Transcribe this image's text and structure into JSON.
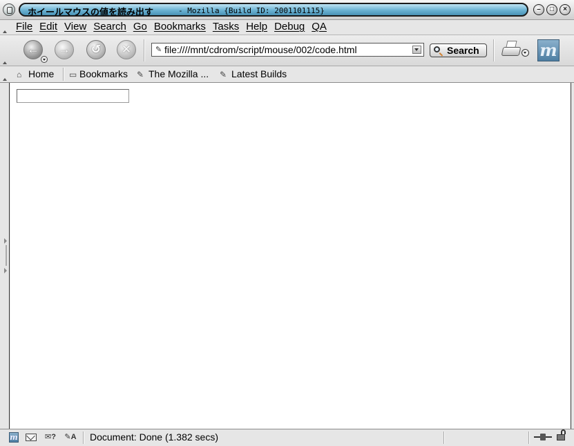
{
  "window": {
    "title_main": "ホイールマウスの値を読み出す",
    "title_sub": "- Mozilla {Build ID: 2001101115}"
  },
  "menu": {
    "items": [
      "File",
      "Edit",
      "View",
      "Search",
      "Go",
      "Bookmarks",
      "Tasks",
      "Help",
      "Debug",
      "QA"
    ]
  },
  "navbar": {
    "url": "file:////mnt/cdrom/script/mouse/002/code.html",
    "search_label": "Search",
    "back_glyph": "←",
    "forward_glyph": "→",
    "reload_glyph": "↺",
    "stop_glyph": "✕",
    "throbber_glyph": "m"
  },
  "personal_toolbar": {
    "home": "Home",
    "bookmarks": "Bookmarks",
    "mozilla": "The Mozilla ...",
    "latest_builds": "Latest Builds"
  },
  "content": {
    "input_value": ""
  },
  "statusbar": {
    "text": "Document: Done (1.382 secs)"
  },
  "colors": {
    "title_pill": "#6bb3d3",
    "chrome": "#e6e6e6",
    "content_bg": "#ffffff",
    "throbber": "#4e7ea3"
  },
  "icons": [
    "window-menu-icon",
    "minimize-icon",
    "maximize-icon",
    "close-icon",
    "back-arrow-icon",
    "forward-arrow-icon",
    "reload-icon",
    "stop-icon",
    "page-icon",
    "search-icon",
    "printer-icon",
    "mozilla-logo-icon",
    "home-icon",
    "folder-icon",
    "bookmark-icon",
    "mail-icon",
    "newsgroup-icon",
    "composer-icon",
    "online-status-icon",
    "lock-icon"
  ]
}
